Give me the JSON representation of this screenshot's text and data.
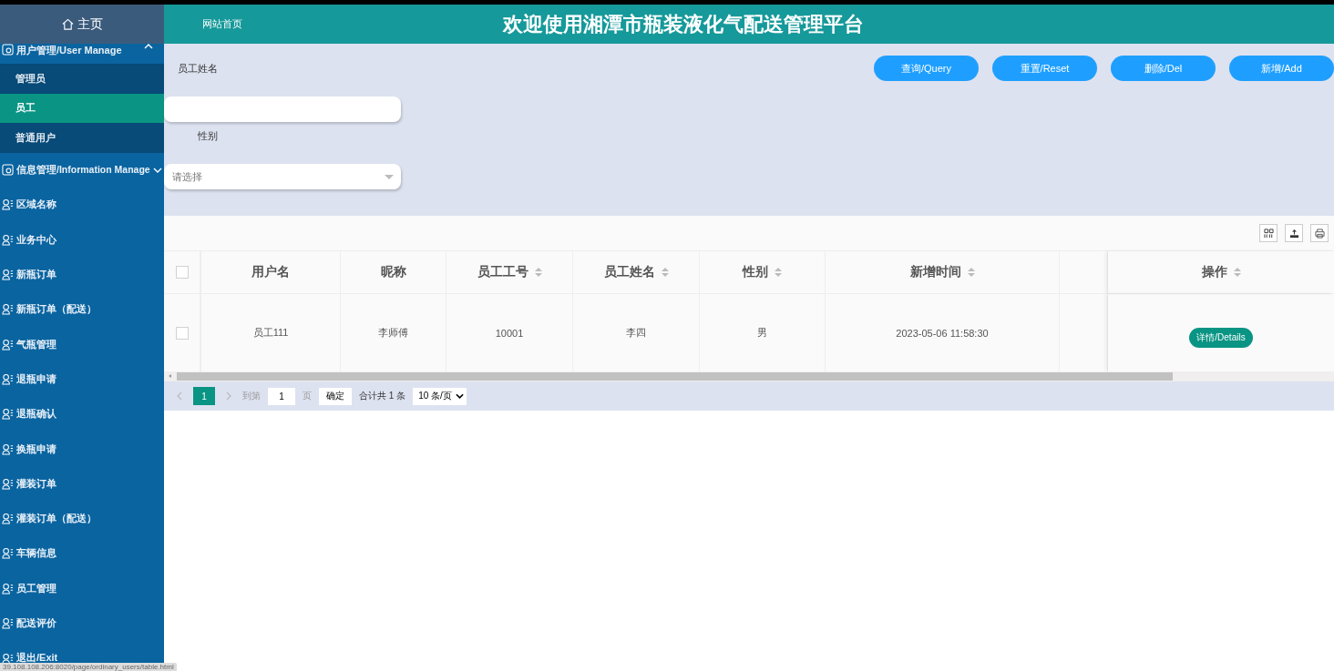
{
  "sidebar": {
    "home": "主页",
    "items": [
      {
        "kind": "group",
        "label": "用户管理/User Manage",
        "expanded": true,
        "children": [
          {
            "label": "管理员",
            "selected": false
          },
          {
            "label": "员工",
            "selected": true
          },
          {
            "label": "普通用户",
            "selected": false
          }
        ]
      },
      {
        "kind": "group",
        "label": "信息管理/Information Manage",
        "expanded": false
      },
      {
        "kind": "item",
        "label": "区域名称"
      },
      {
        "kind": "item",
        "label": "业务中心"
      },
      {
        "kind": "item",
        "label": "新瓶订单"
      },
      {
        "kind": "item",
        "label": "新瓶订单（配送）"
      },
      {
        "kind": "item",
        "label": "气瓶管理"
      },
      {
        "kind": "item",
        "label": "退瓶申请"
      },
      {
        "kind": "item",
        "label": "退瓶确认"
      },
      {
        "kind": "item",
        "label": "换瓶申请"
      },
      {
        "kind": "item",
        "label": "灌装订单"
      },
      {
        "kind": "item",
        "label": "灌装订单（配送）"
      },
      {
        "kind": "item",
        "label": "车辆信息"
      },
      {
        "kind": "item",
        "label": "员工管理"
      },
      {
        "kind": "item",
        "label": "配送评价"
      },
      {
        "kind": "item",
        "label": "退出/Exit"
      }
    ]
  },
  "header": {
    "link": "网站首页",
    "title": "欢迎使用湘潭市瓶装液化气配送管理平台"
  },
  "filters": [
    {
      "kind": "input",
      "label": "员工姓名"
    },
    {
      "kind": "select",
      "label": "性别",
      "placeholder": "请选择"
    }
  ],
  "buttons": [
    "查询/Query",
    "重置/Reset",
    "删除/Del",
    "新增/Add"
  ],
  "table": {
    "columns": [
      {
        "label": "用户名",
        "sortable": false
      },
      {
        "label": "昵称",
        "sortable": false
      },
      {
        "label": "员工工号",
        "sortable": true
      },
      {
        "label": "员工姓名",
        "sortable": true
      },
      {
        "label": "性别",
        "sortable": true
      },
      {
        "label": "新增时间",
        "sortable": true
      },
      {
        "sortable": false
      }
    ],
    "select_all_checked": false,
    "action_column": {
      "label": "操作",
      "sortable": true
    },
    "rows": [
      {
        "checked": false,
        "cells": [
          "员工111",
          "李师傅",
          "10001",
          "李四",
          "男",
          "2023-05-06 11:58:30"
        ],
        "action": "详情/Details"
      }
    ]
  },
  "pagination": {
    "pages": [
      {
        "label": "1",
        "selected": true
      }
    ],
    "goto_label": "到第",
    "goto_value": "1",
    "page_unit": "页",
    "confirm": "确定",
    "total": "合计共 1 条",
    "page_size": "10 条/页"
  },
  "status_url": "39.108.108.206:8020/page/ordinary_users/table.html"
}
